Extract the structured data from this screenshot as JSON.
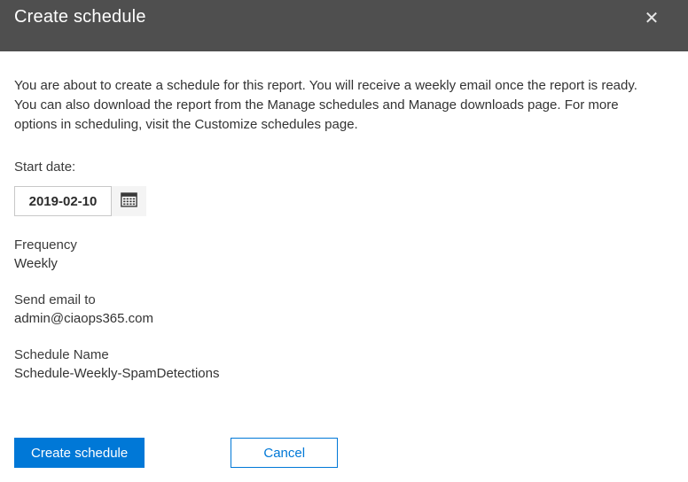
{
  "dialog": {
    "title": "Create schedule",
    "description": "You are about to create a schedule for this report. You will receive a weekly email once the report is ready. You can also download the report from the Manage schedules and Manage downloads page. For more options in scheduling, visit the Customize schedules page."
  },
  "fields": {
    "start_date": {
      "label": "Start date:",
      "value": "2019-02-10"
    },
    "frequency": {
      "label": "Frequency",
      "value": "Weekly"
    },
    "send_email_to": {
      "label": "Send email to",
      "value": "admin@ciaops365.com"
    },
    "schedule_name": {
      "label": "Schedule Name",
      "value": "Schedule-Weekly-SpamDetections"
    }
  },
  "buttons": {
    "create": "Create schedule",
    "cancel": "Cancel"
  },
  "icons": {
    "close": "close-icon",
    "calendar": "calendar-icon"
  },
  "colors": {
    "accent": "#0078d7",
    "header_bg": "#4f4f4f",
    "text": "#333333"
  }
}
